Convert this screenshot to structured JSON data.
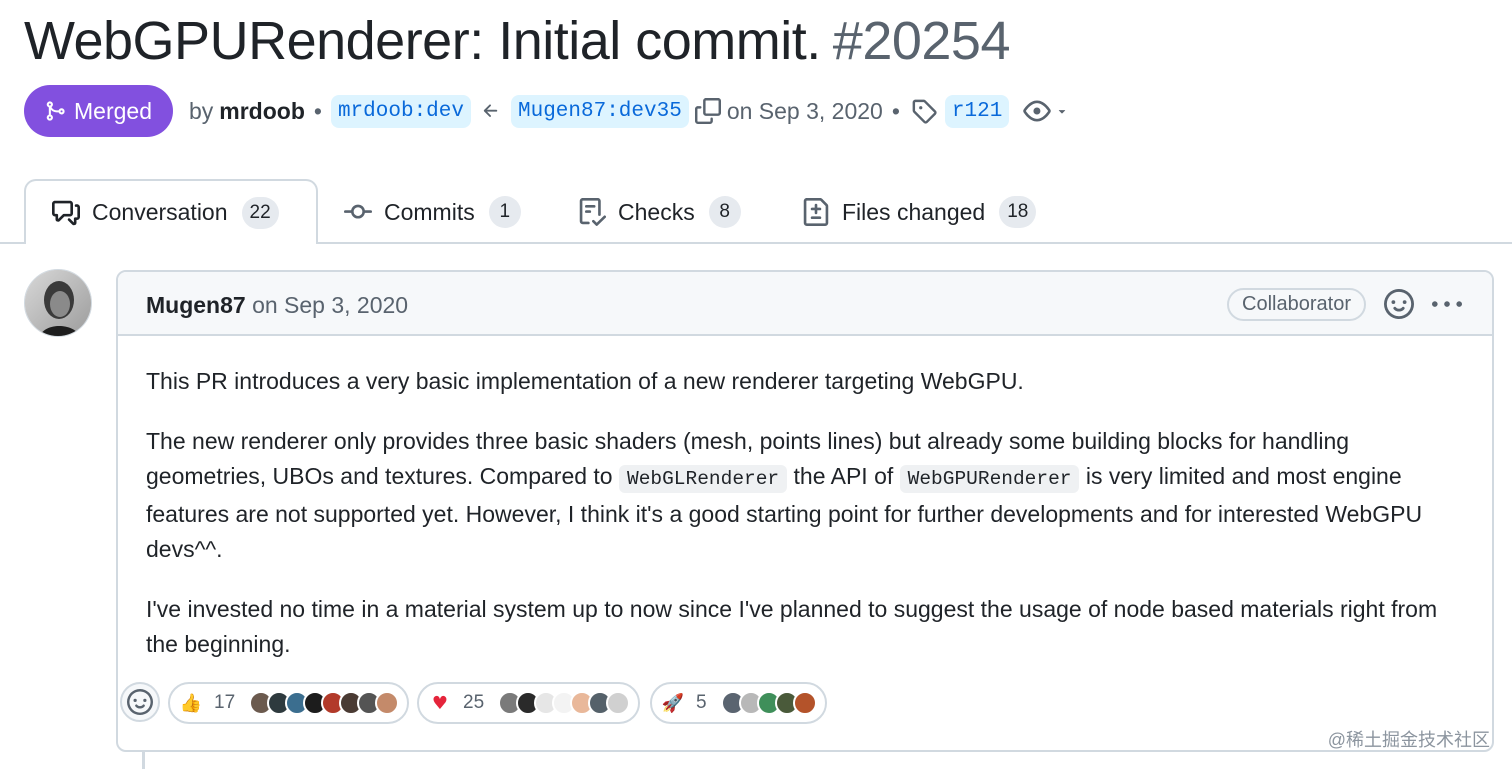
{
  "pr": {
    "title": "WebGPURenderer: Initial commit.",
    "number": "#20254",
    "state": "Merged",
    "by_prefix": "by",
    "author": "mrdoob",
    "base_branch": "mrdoob:dev",
    "head_branch": "Mugen87:dev35",
    "date_text": "on Sep 3, 2020",
    "label": "r121"
  },
  "tabs": [
    {
      "label": "Conversation",
      "count": "22",
      "icon": "comment-discussion-icon"
    },
    {
      "label": "Commits",
      "count": "1",
      "icon": "git-commit-icon"
    },
    {
      "label": "Checks",
      "count": "8",
      "icon": "checklist-icon"
    },
    {
      "label": "Files changed",
      "count": "18",
      "icon": "file-diff-icon"
    }
  ],
  "comment": {
    "author": "Mugen87",
    "date": "on Sep 3, 2020",
    "role_badge": "Collaborator",
    "p1": "This PR introduces a very basic implementation of a new renderer targeting WebGPU.",
    "p2_a": "The new renderer only provides three basic shaders (mesh, points lines) but already some building blocks for handling geometries, UBOs and textures. Compared to ",
    "p2_code1": "WebGLRenderer",
    "p2_b": " the API of ",
    "p2_code2": "WebGPURenderer",
    "p2_c": " is very limited and most engine features are not supported yet. However, I think it's a good starting point for further developments and for interested WebGPU devs^^.",
    "p3": "I've invested no time in a material system up to now since I've planned to suggest the usage of node based materials right from the beginning."
  },
  "reactions": [
    {
      "emoji": "👍",
      "count": "17"
    },
    {
      "emoji": "♥",
      "count": "25",
      "color": "#e5243b"
    },
    {
      "emoji": "🚀",
      "count": "5"
    }
  ],
  "colors": {
    "merged": "#8250df",
    "link": "#0969da",
    "branch_bg": "#ddf4ff",
    "border": "#d1d9e0",
    "muted": "#59636e"
  },
  "watermark": "@稀土掘金技术社区"
}
